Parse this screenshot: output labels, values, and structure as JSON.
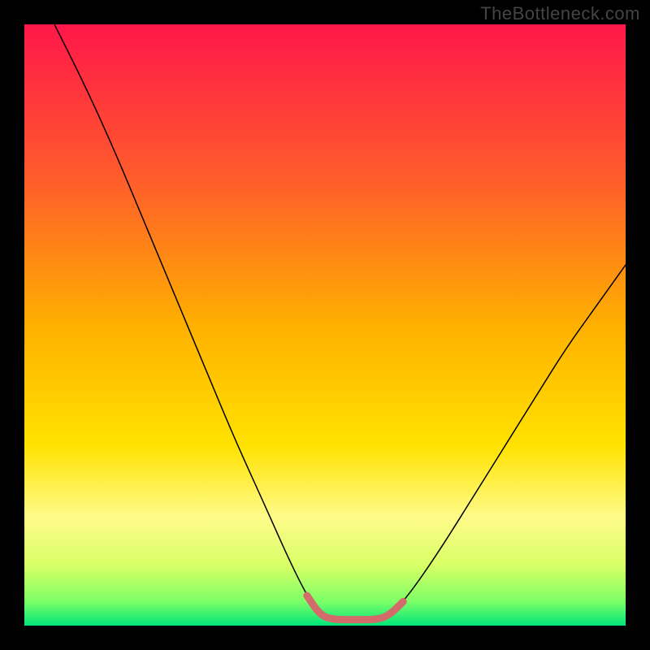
{
  "watermark": "TheBottleneck.com",
  "chart_data": {
    "type": "line",
    "title": "",
    "xlabel": "",
    "ylabel": "",
    "xlim": [
      0,
      100
    ],
    "ylim": [
      0,
      100
    ],
    "background_gradient": {
      "stops": [
        {
          "offset": 0.0,
          "color": "#ff1749"
        },
        {
          "offset": 0.25,
          "color": "#ff5a2c"
        },
        {
          "offset": 0.5,
          "color": "#ffb000"
        },
        {
          "offset": 0.7,
          "color": "#ffe200"
        },
        {
          "offset": 0.82,
          "color": "#fffb8a"
        },
        {
          "offset": 0.9,
          "color": "#d8ff66"
        },
        {
          "offset": 0.96,
          "color": "#7cff66"
        },
        {
          "offset": 1.0,
          "color": "#00e57a"
        }
      ]
    },
    "series": [
      {
        "name": "bottleneck-curve",
        "stroke": "#000000",
        "stroke_width": 1.5,
        "points": [
          {
            "x": 5,
            "y": 100
          },
          {
            "x": 10,
            "y": 90
          },
          {
            "x": 15,
            "y": 79
          },
          {
            "x": 20,
            "y": 67
          },
          {
            "x": 25,
            "y": 55
          },
          {
            "x": 30,
            "y": 43
          },
          {
            "x": 35,
            "y": 31
          },
          {
            "x": 40,
            "y": 20
          },
          {
            "x": 44,
            "y": 11
          },
          {
            "x": 47,
            "y": 5
          },
          {
            "x": 49,
            "y": 2
          },
          {
            "x": 51,
            "y": 1
          },
          {
            "x": 55,
            "y": 1
          },
          {
            "x": 59,
            "y": 1
          },
          {
            "x": 61,
            "y": 2
          },
          {
            "x": 63,
            "y": 4
          },
          {
            "x": 66,
            "y": 8
          },
          {
            "x": 70,
            "y": 14
          },
          {
            "x": 75,
            "y": 22
          },
          {
            "x": 80,
            "y": 30
          },
          {
            "x": 85,
            "y": 38
          },
          {
            "x": 90,
            "y": 46
          },
          {
            "x": 95,
            "y": 53
          },
          {
            "x": 100,
            "y": 60
          }
        ]
      },
      {
        "name": "optimal-zone-highlight",
        "stroke": "#d36b6b",
        "stroke_width": 9,
        "points": [
          {
            "x": 47,
            "y": 5
          },
          {
            "x": 49,
            "y": 2
          },
          {
            "x": 51,
            "y": 1
          },
          {
            "x": 55,
            "y": 1
          },
          {
            "x": 59,
            "y": 1
          },
          {
            "x": 61,
            "y": 2
          },
          {
            "x": 63,
            "y": 4
          }
        ]
      }
    ]
  }
}
